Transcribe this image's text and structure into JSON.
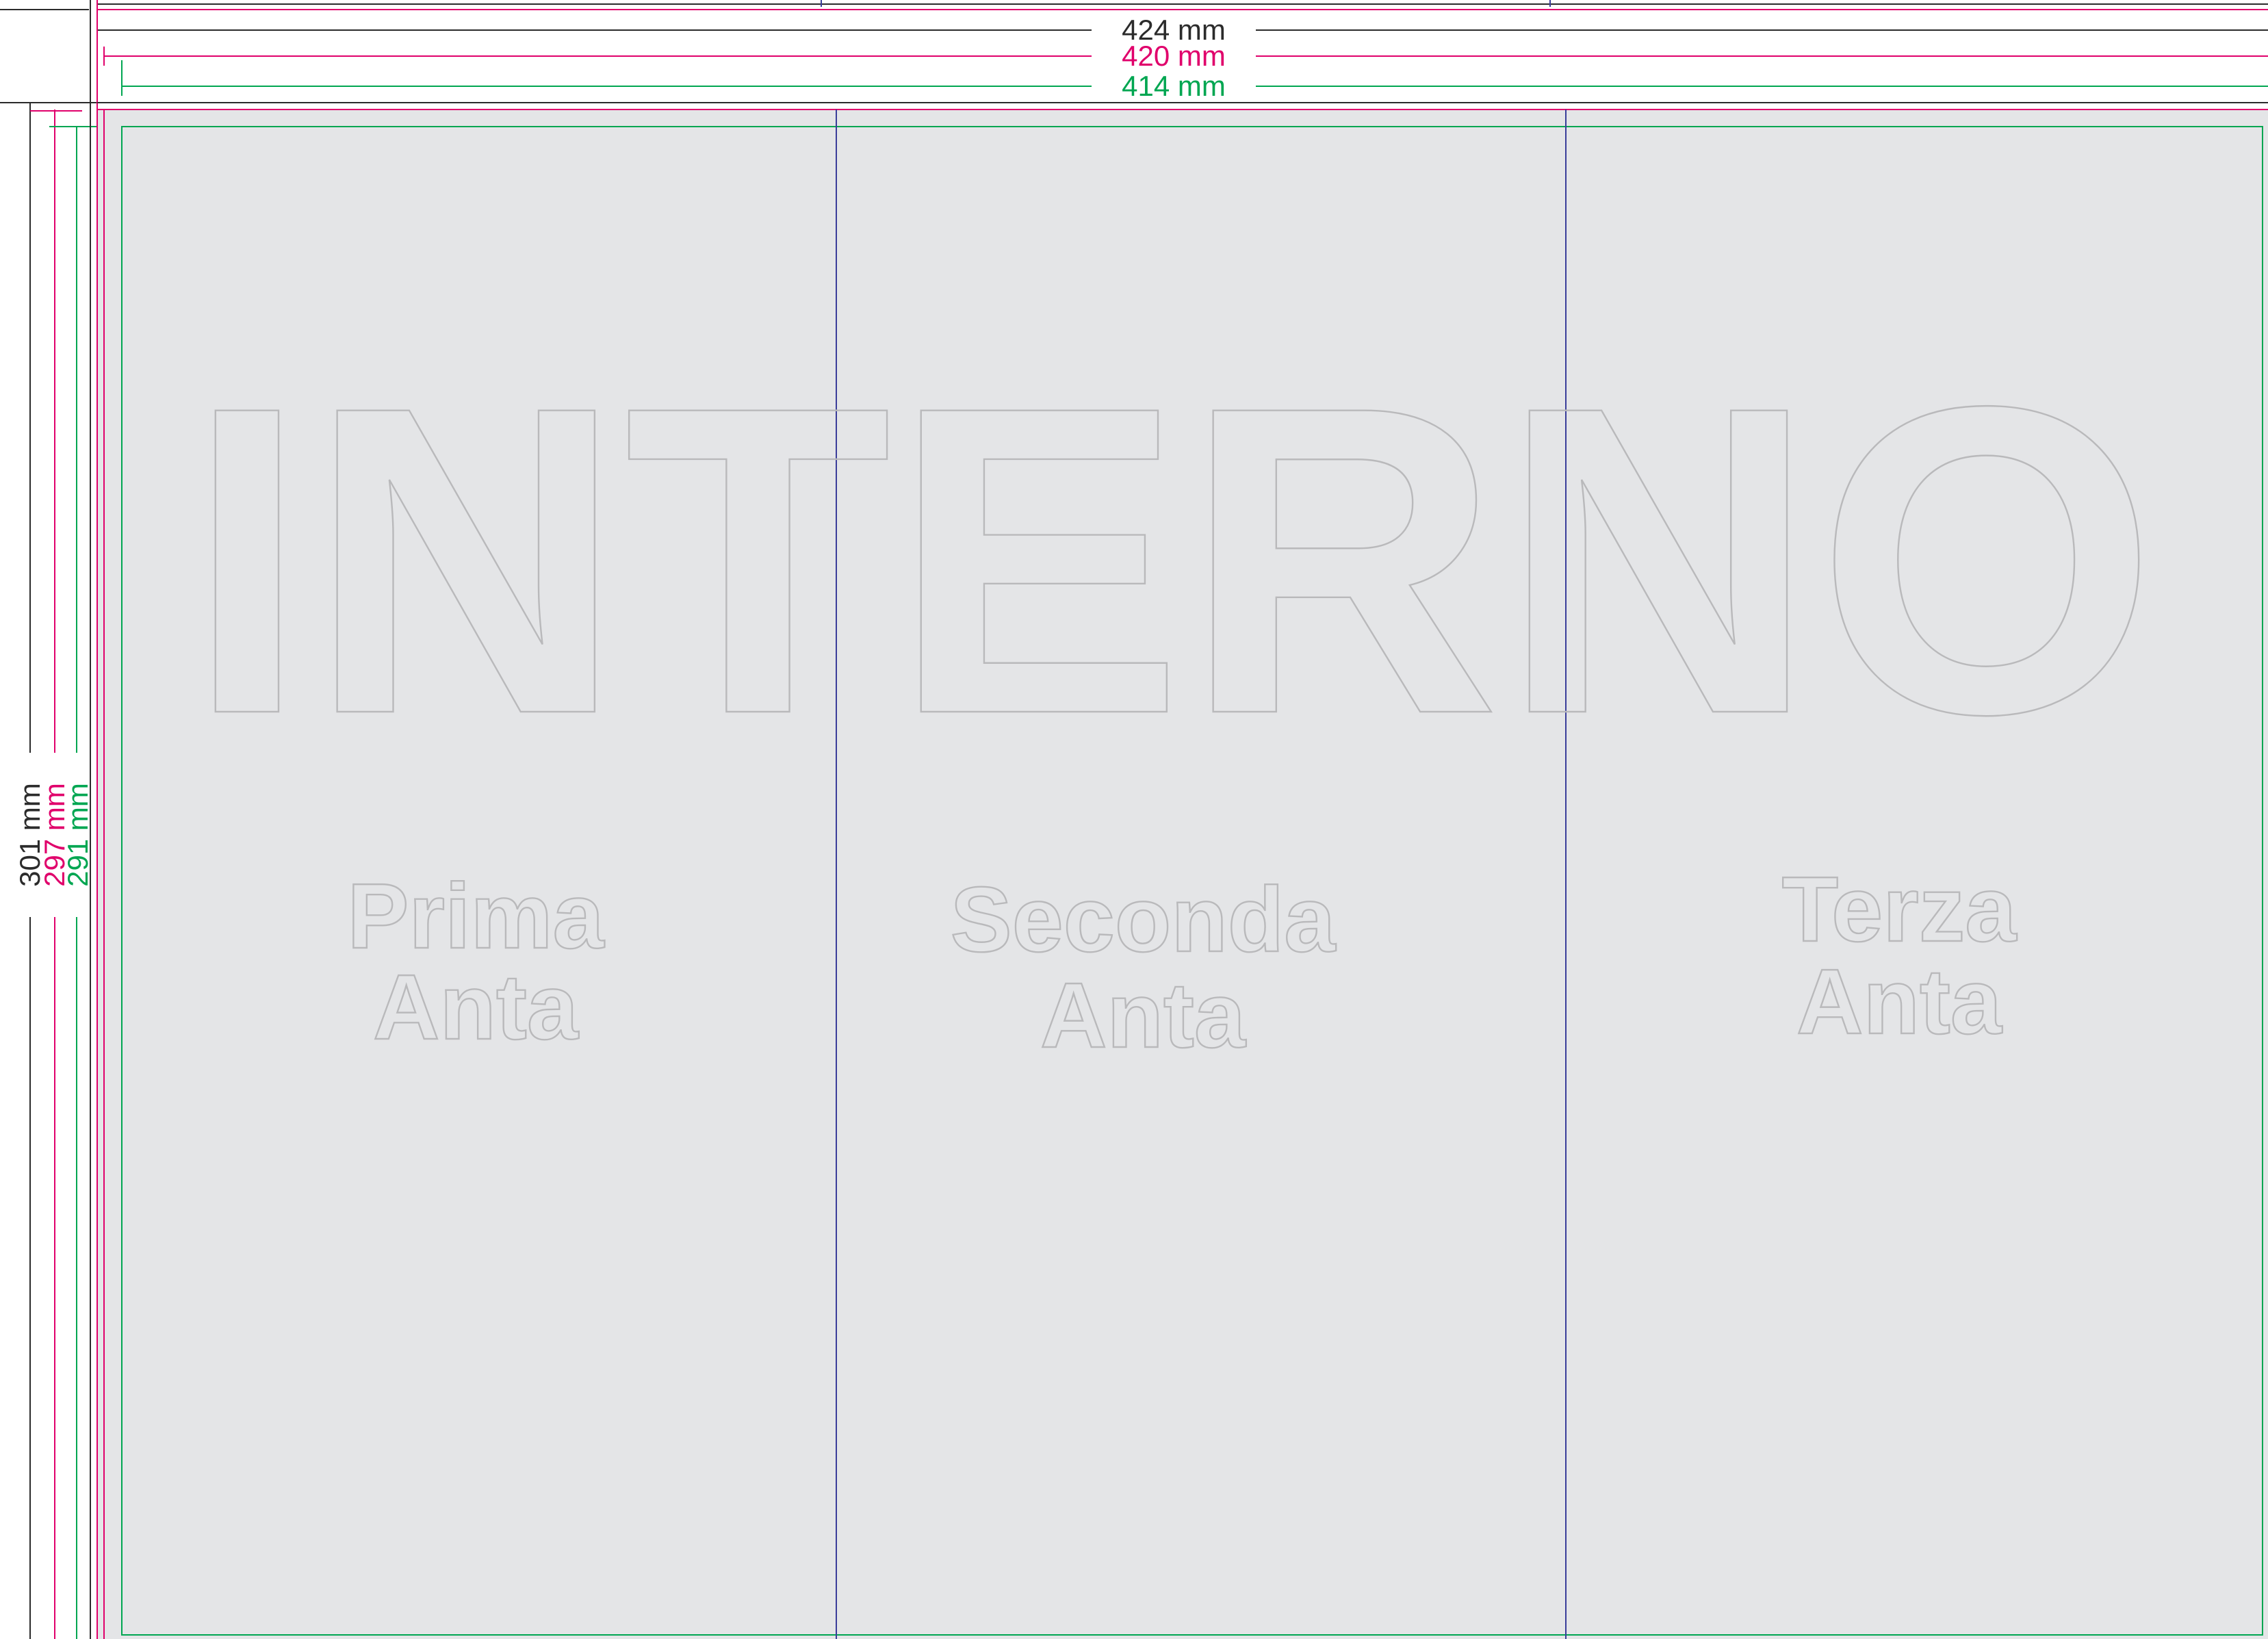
{
  "colors": {
    "background": "#ffffff",
    "panel": "#e4e5e7",
    "bleed_line": "#2b2b2b",
    "trim_line": "#e0006b",
    "safe_line": "#00a651",
    "fold_line": "#3a3d9a",
    "ghost_text": "#b9b9bb"
  },
  "dimensions": {
    "width_bleed": "424 mm",
    "width_trim": "420 mm",
    "width_safe": "414 mm",
    "height_bleed": "301 mm",
    "height_trim": "297 mm",
    "height_safe": "291 mm"
  },
  "watermark": "INTERNO",
  "panels": [
    {
      "line1": "Prima",
      "line2": "Anta"
    },
    {
      "line1": "Seconda",
      "line2": "Anta"
    },
    {
      "line1": "Terza",
      "line2": "Anta"
    }
  ]
}
